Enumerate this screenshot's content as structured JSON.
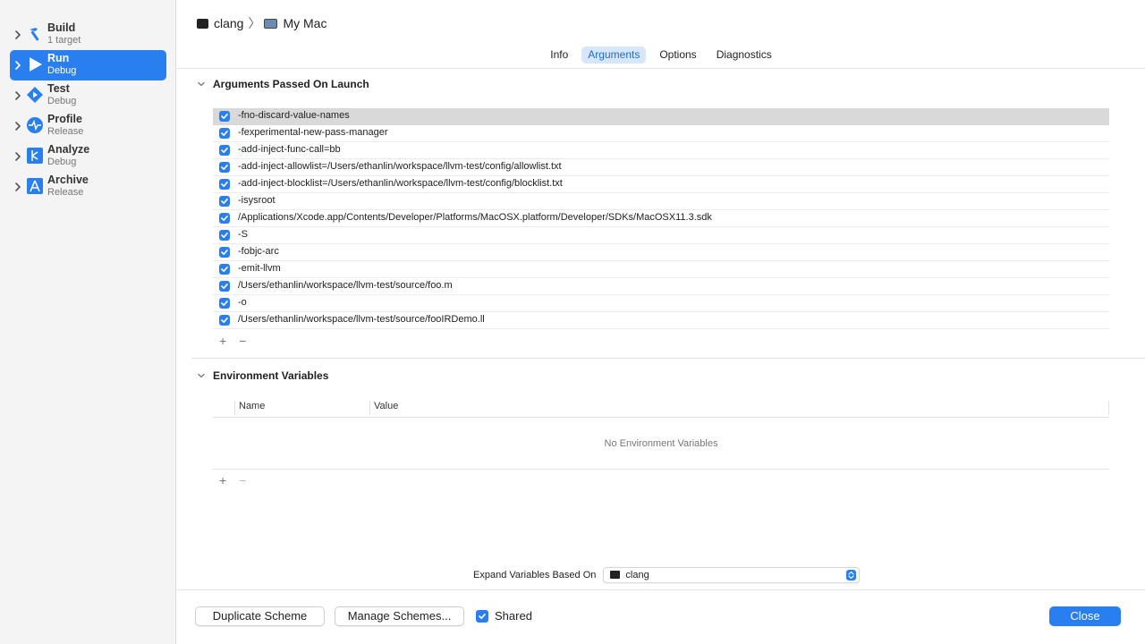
{
  "sidebar": {
    "items": [
      {
        "title": "Build",
        "subtitle": "1 target",
        "icon": "hammer-icon",
        "active": false
      },
      {
        "title": "Run",
        "subtitle": "Debug",
        "icon": "play-icon",
        "active": true
      },
      {
        "title": "Test",
        "subtitle": "Debug",
        "icon": "test-diamond-icon",
        "active": false
      },
      {
        "title": "Profile",
        "subtitle": "Release",
        "icon": "instruments-icon",
        "active": false
      },
      {
        "title": "Analyze",
        "subtitle": "Debug",
        "icon": "analyze-icon",
        "active": false
      },
      {
        "title": "Archive",
        "subtitle": "Release",
        "icon": "archive-icon",
        "active": false
      }
    ]
  },
  "breadcrumb": {
    "scheme": "clang",
    "destination": "My Mac",
    "separator": "〉"
  },
  "tabs": [
    {
      "label": "Info",
      "active": false
    },
    {
      "label": "Arguments",
      "active": true
    },
    {
      "label": "Options",
      "active": false
    },
    {
      "label": "Diagnostics",
      "active": false
    }
  ],
  "arguments": {
    "title": "Arguments Passed On Launch",
    "items": [
      {
        "text": "-fno-discard-value-names",
        "checked": true,
        "selected": true
      },
      {
        "text": "-fexperimental-new-pass-manager",
        "checked": true
      },
      {
        "text": "-add-inject-func-call=bb",
        "checked": true
      },
      {
        "text": "-add-inject-allowlist=/Users/ethanlin/workspace/llvm-test/config/allowlist.txt",
        "checked": true
      },
      {
        "text": "-add-inject-blocklist=/Users/ethanlin/workspace/llvm-test/config/blocklist.txt",
        "checked": true
      },
      {
        "text": "-isysroot",
        "checked": true
      },
      {
        "text": "/Applications/Xcode.app/Contents/Developer/Platforms/MacOSX.platform/Developer/SDKs/MacOSX11.3.sdk",
        "checked": true
      },
      {
        "text": "-S",
        "checked": true
      },
      {
        "text": "-fobjc-arc",
        "checked": true
      },
      {
        "text": "-emit-llvm",
        "checked": true
      },
      {
        "text": "/Users/ethanlin/workspace/llvm-test/source/foo.m",
        "checked": true
      },
      {
        "text": "-o",
        "checked": true
      },
      {
        "text": "/Users/ethanlin/workspace/llvm-test/source/fooIRDemo.ll",
        "checked": true
      }
    ],
    "add_label": "+",
    "remove_label": "−"
  },
  "environment": {
    "title": "Environment Variables",
    "columns": [
      "Name",
      "Value"
    ],
    "empty_text": "No Environment Variables",
    "add_label": "+",
    "remove_label": "−"
  },
  "expand": {
    "label": "Expand Variables Based On",
    "value": "clang"
  },
  "footer": {
    "duplicate_label": "Duplicate Scheme",
    "manage_label": "Manage Schemes...",
    "shared_label": "Shared",
    "shared_checked": true,
    "close_label": "Close"
  },
  "colors": {
    "accent": "#2a7ff0",
    "selected_row": "#d9d9d9",
    "tab_active_bg": "#d7e6fb"
  }
}
